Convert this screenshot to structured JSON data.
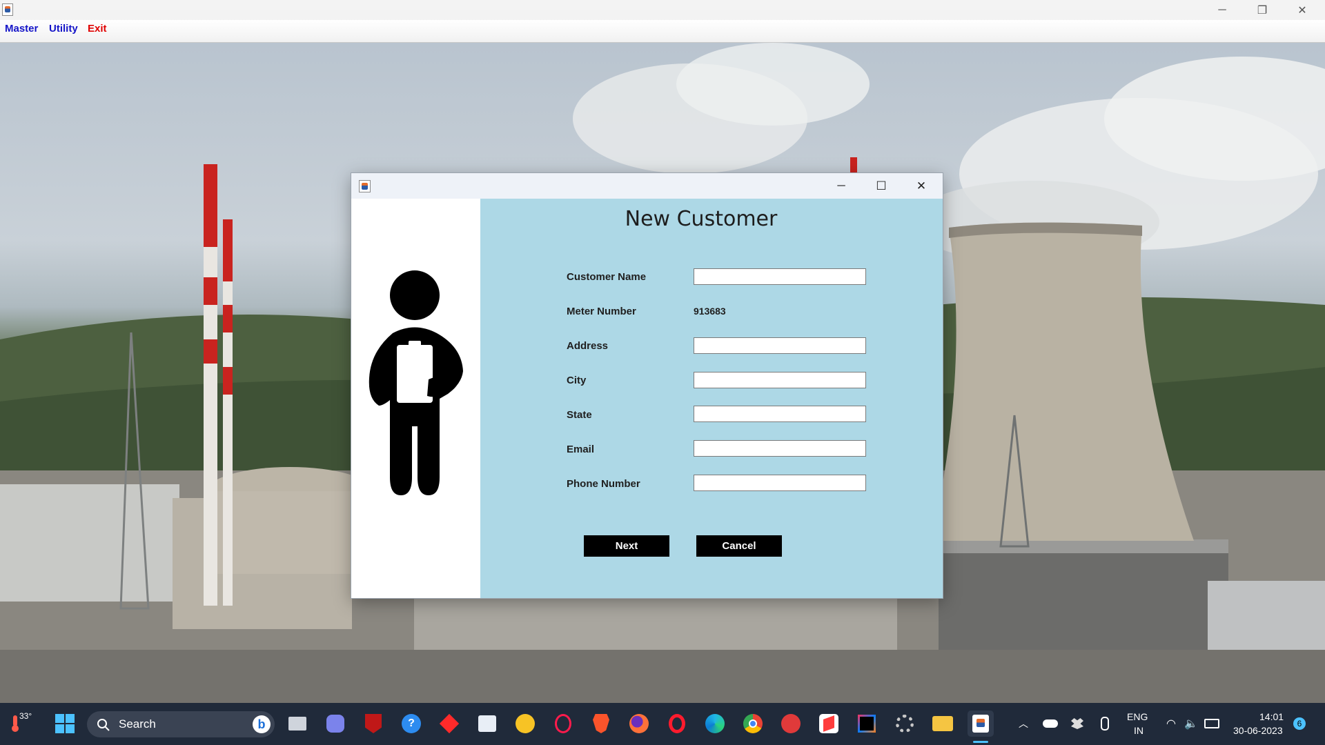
{
  "main_window": {
    "menu": [
      {
        "label": "Master"
      },
      {
        "label": "Utility"
      },
      {
        "label": "Exit"
      }
    ],
    "controls": {
      "minimize": "─",
      "restore": "❐",
      "close": "✕"
    }
  },
  "dialog": {
    "title": "New Customer",
    "controls": {
      "minimize": "─",
      "maximize": "☐",
      "close": "✕"
    },
    "fields": [
      {
        "label": "Customer Name",
        "value": "",
        "type": "input"
      },
      {
        "label": "Meter Number",
        "value": "913683",
        "type": "text"
      },
      {
        "label": "Address",
        "value": "",
        "type": "input"
      },
      {
        "label": "City",
        "value": "",
        "type": "input"
      },
      {
        "label": "State",
        "value": "",
        "type": "input"
      },
      {
        "label": "Email",
        "value": "",
        "type": "input"
      },
      {
        "label": "Phone Number",
        "value": "",
        "type": "input"
      }
    ],
    "buttons": {
      "next": "Next",
      "cancel": "Cancel"
    },
    "background_color": "#add8e6"
  },
  "taskbar": {
    "weather": {
      "temp": "33°"
    },
    "search_placeholder": "Search",
    "apps": [
      "windows-start",
      "bing",
      "task-view",
      "teams-chat",
      "mcafee",
      "help",
      "red-app",
      "store",
      "yellow-app",
      "opera-gx",
      "brave",
      "firefox",
      "opera",
      "edge",
      "chrome",
      "red-circle-app",
      "sublime",
      "intellij",
      "settings",
      "file-explorer",
      "java"
    ],
    "tray": {
      "language": "ENG",
      "region": "IN",
      "time": "14:01",
      "date": "30-06-2023",
      "notifications": "6"
    }
  }
}
